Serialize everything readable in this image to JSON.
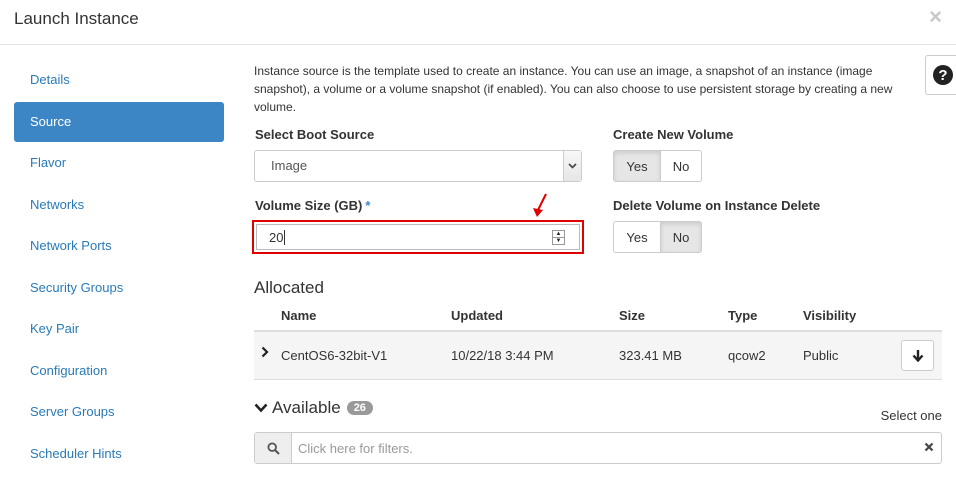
{
  "modal": {
    "title": "Launch Instance",
    "close_icon": "×"
  },
  "sidebar": {
    "items": [
      {
        "label": "Details",
        "active": false
      },
      {
        "label": "Source",
        "active": true
      },
      {
        "label": "Flavor",
        "active": false
      },
      {
        "label": "Networks",
        "active": false
      },
      {
        "label": "Network Ports",
        "active": false
      },
      {
        "label": "Security Groups",
        "active": false
      },
      {
        "label": "Key Pair",
        "active": false
      },
      {
        "label": "Configuration",
        "active": false
      },
      {
        "label": "Server Groups",
        "active": false
      },
      {
        "label": "Scheduler Hints",
        "active": false
      }
    ]
  },
  "help": {
    "icon": "?"
  },
  "intro": "Instance source is the template used to create an instance. You can use an image, a snapshot of an instance (image snapshot), a volume or a volume snapshot (if enabled). You can also choose to use persistent storage by creating a new volume.",
  "boot_source": {
    "label": "Select Boot Source",
    "value": "Image"
  },
  "create_volume": {
    "label": "Create New Volume",
    "yes": "Yes",
    "no": "No",
    "selected": "Yes"
  },
  "volume_size": {
    "label": "Volume Size (GB)",
    "required_mark": "*",
    "value": "20"
  },
  "delete_volume": {
    "label": "Delete Volume on Instance Delete",
    "yes": "Yes",
    "no": "No",
    "selected": "No"
  },
  "allocated": {
    "title": "Allocated",
    "columns": [
      "Name",
      "Updated",
      "Size",
      "Type",
      "Visibility"
    ],
    "rows": [
      {
        "name": "CentOS6-32bit-V1",
        "updated": "10/22/18 3:44 PM",
        "size": "323.41 MB",
        "type": "qcow2",
        "visibility": "Public"
      }
    ]
  },
  "available": {
    "title": "Available",
    "count": "26",
    "select_hint": "Select one"
  },
  "filter": {
    "placeholder": "Click here for filters."
  },
  "colors": {
    "accent": "#3d86c6",
    "link": "#2a7ab8",
    "highlight": "#e00000"
  }
}
